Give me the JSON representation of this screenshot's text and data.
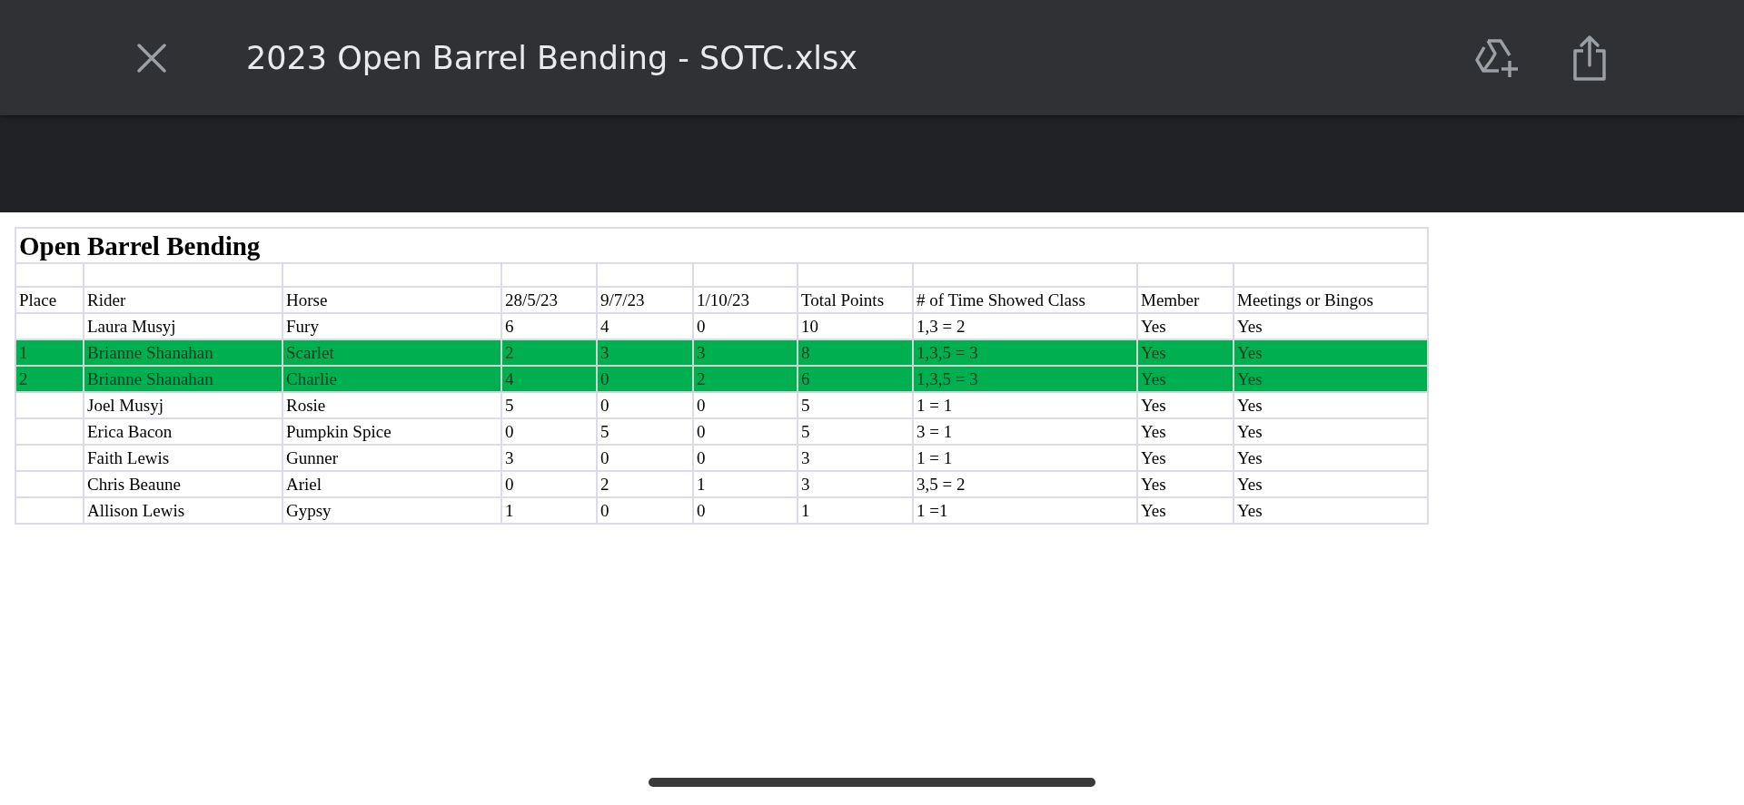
{
  "window": {
    "title": "2023 Open Barrel Bending - SOTC.xlsx"
  },
  "sheet": {
    "title": "Open Barrel Bending",
    "columns": [
      "Place",
      "Rider",
      "Horse",
      "28/5/23",
      "9/7/23",
      "1/10/23",
      "Total Points",
      "# of Time Showed Class",
      "Member",
      "Meetings or Bingos"
    ],
    "rows": [
      {
        "highlighted": false,
        "cells": [
          "",
          "Laura Musyj",
          "Fury",
          "6",
          "4",
          "0",
          "10",
          "1,3 = 2",
          "Yes",
          "Yes"
        ]
      },
      {
        "highlighted": true,
        "cells": [
          "1",
          "Brianne Shanahan",
          "Scarlet",
          "2",
          "3",
          "3",
          "8",
          "1,3,5 = 3",
          "Yes",
          "Yes"
        ]
      },
      {
        "highlighted": true,
        "cells": [
          "2",
          "Brianne Shanahan",
          "Charlie",
          "4",
          "0",
          "2",
          "6",
          "1,3,5 = 3",
          "Yes",
          "Yes"
        ]
      },
      {
        "highlighted": false,
        "cells": [
          "",
          "Joel Musyj",
          "Rosie",
          "5",
          "0",
          "0",
          "5",
          "1 = 1",
          "Yes",
          "Yes"
        ]
      },
      {
        "highlighted": false,
        "cells": [
          "",
          "Erica Bacon",
          "Pumpkin Spice",
          "0",
          "5",
          "0",
          "5",
          "3 = 1",
          "Yes",
          "Yes"
        ]
      },
      {
        "highlighted": false,
        "cells": [
          "",
          "Faith Lewis",
          "Gunner",
          "3",
          "0",
          "0",
          "3",
          "1 = 1",
          "Yes",
          "Yes"
        ]
      },
      {
        "highlighted": false,
        "cells": [
          "",
          "Chris Beaune",
          "Ariel",
          "0",
          "2",
          "1",
          "3",
          "3,5 = 2",
          "Yes",
          "Yes"
        ]
      },
      {
        "highlighted": false,
        "cells": [
          "",
          "Allison Lewis",
          "Gypsy",
          "1",
          "0",
          "0",
          "1",
          "1 =1",
          "Yes",
          "Yes"
        ]
      }
    ]
  }
}
